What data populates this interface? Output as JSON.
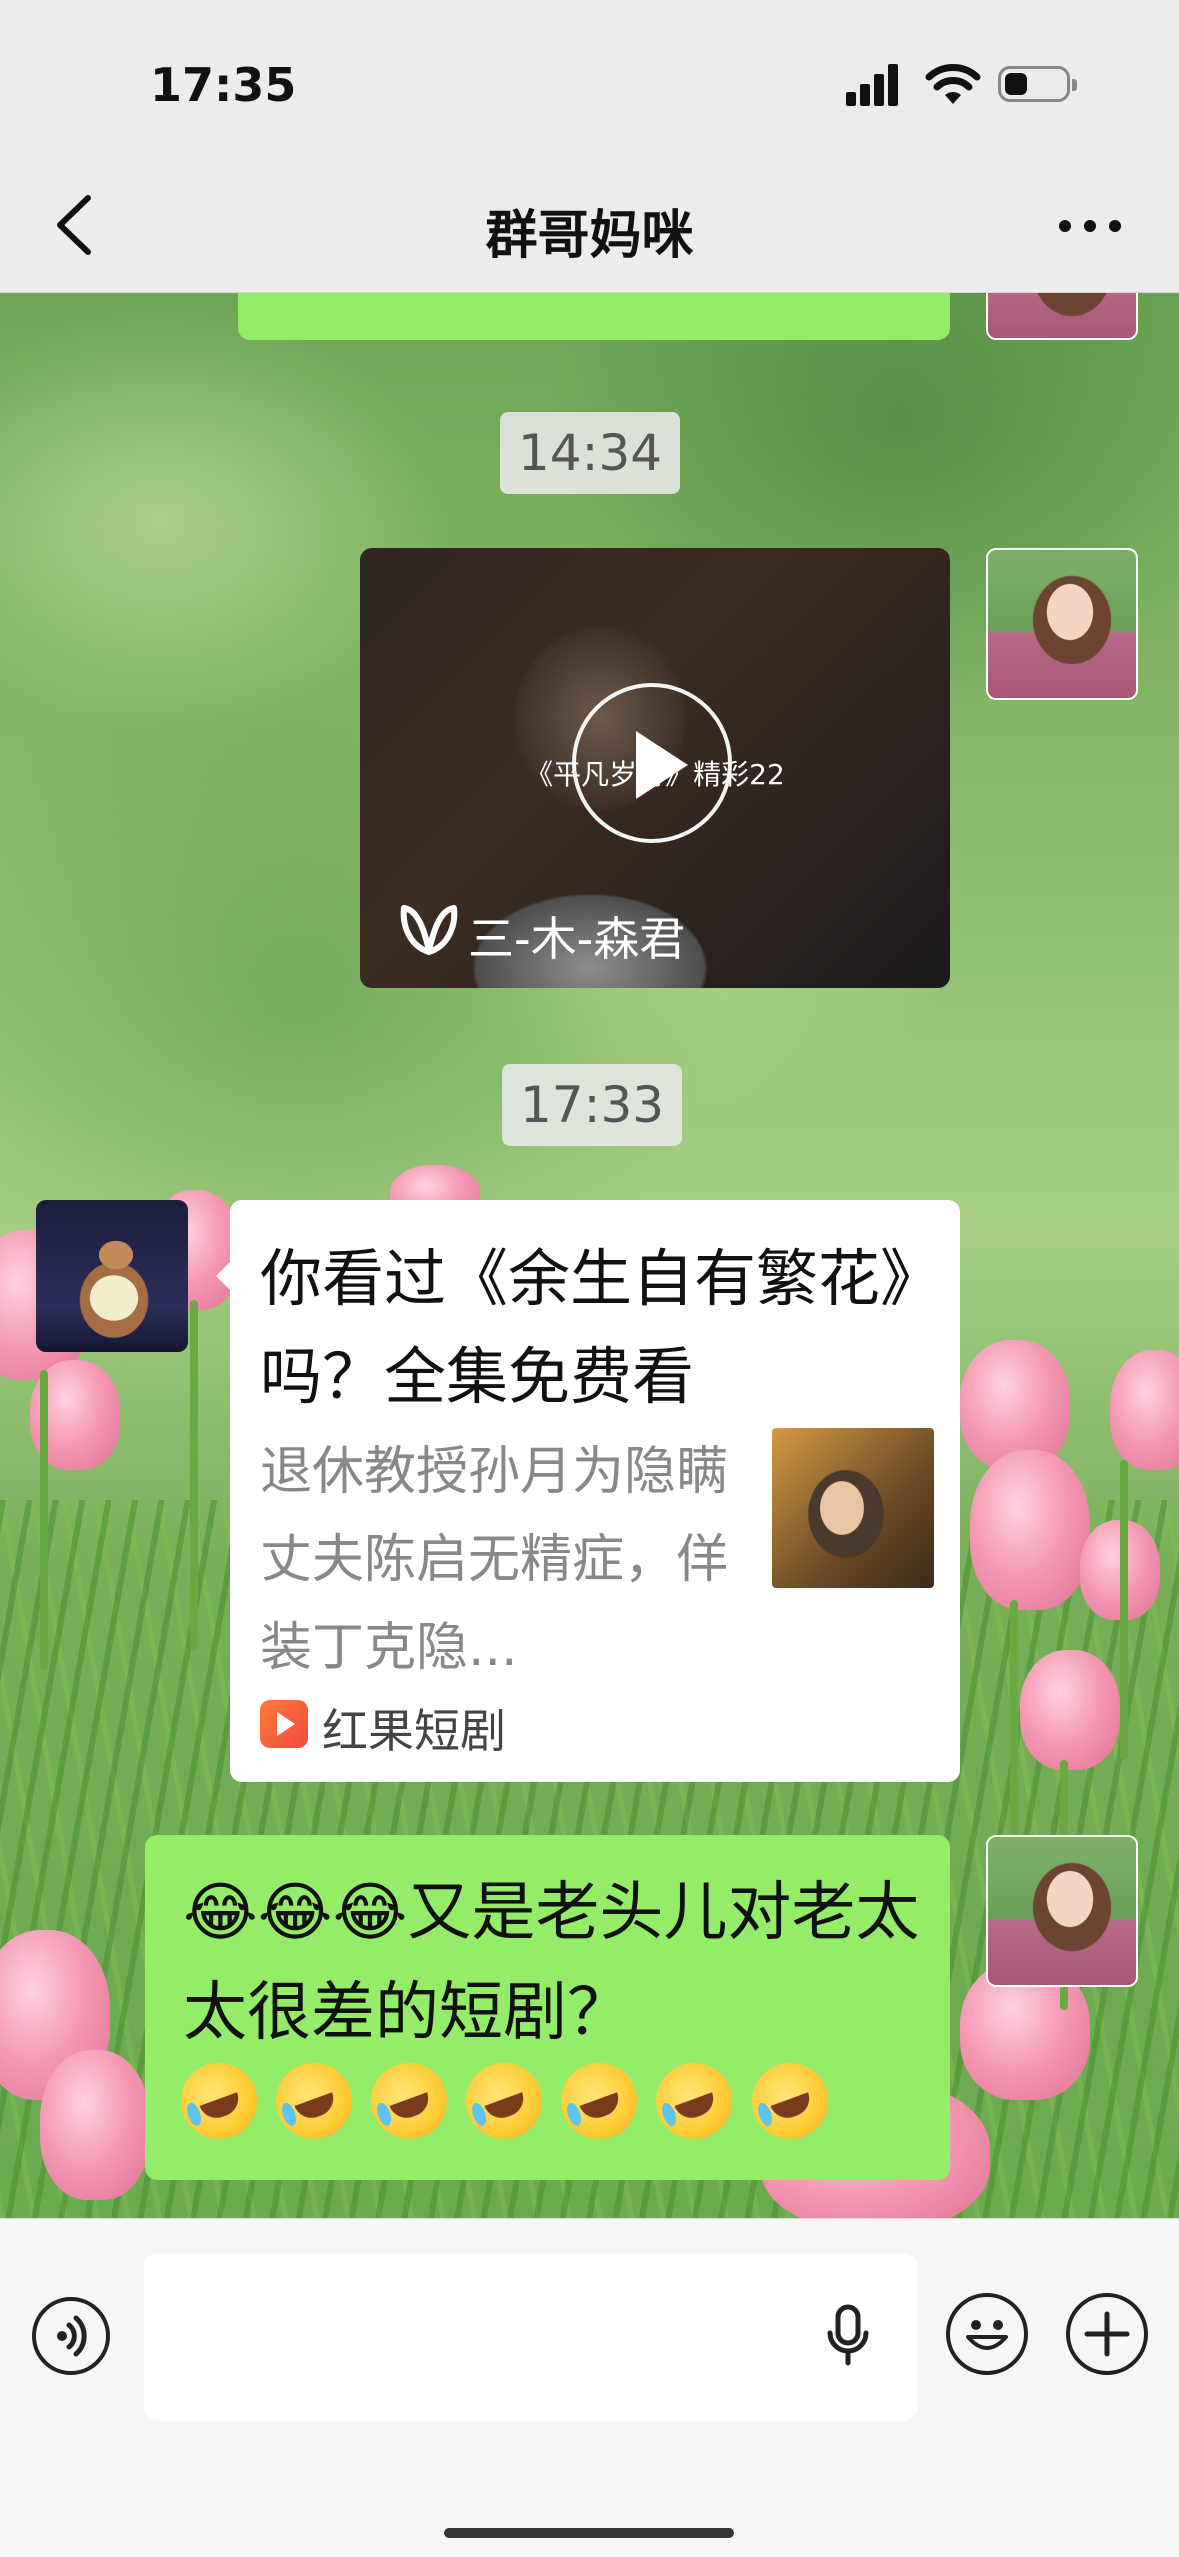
{
  "status_bar": {
    "time": "17:35"
  },
  "header": {
    "title": "群哥妈咪"
  },
  "messages": {
    "timestamp_1": "14:34",
    "video": {
      "caption": "《平凡岁月》精彩22",
      "author": "三-木-森君"
    },
    "timestamp_2": "17:33",
    "link_card": {
      "title": "你看过《余生自有繁花》吗？全集免费看",
      "description": "退休教授孙月为隐瞒丈夫陈启无精症，佯装丁克隐...",
      "source": "红果短剧"
    },
    "reply": {
      "text": "😂😂😂又是老头儿对老太太很差的短剧？",
      "emoji_count": 7,
      "emoji_icon": "rofl-emoji"
    }
  },
  "input_bar": {
    "placeholder": ""
  },
  "colors": {
    "bubble_green": "#95ec69",
    "header_bg": "#ececec",
    "input_bar_bg": "#f6f6f6"
  }
}
